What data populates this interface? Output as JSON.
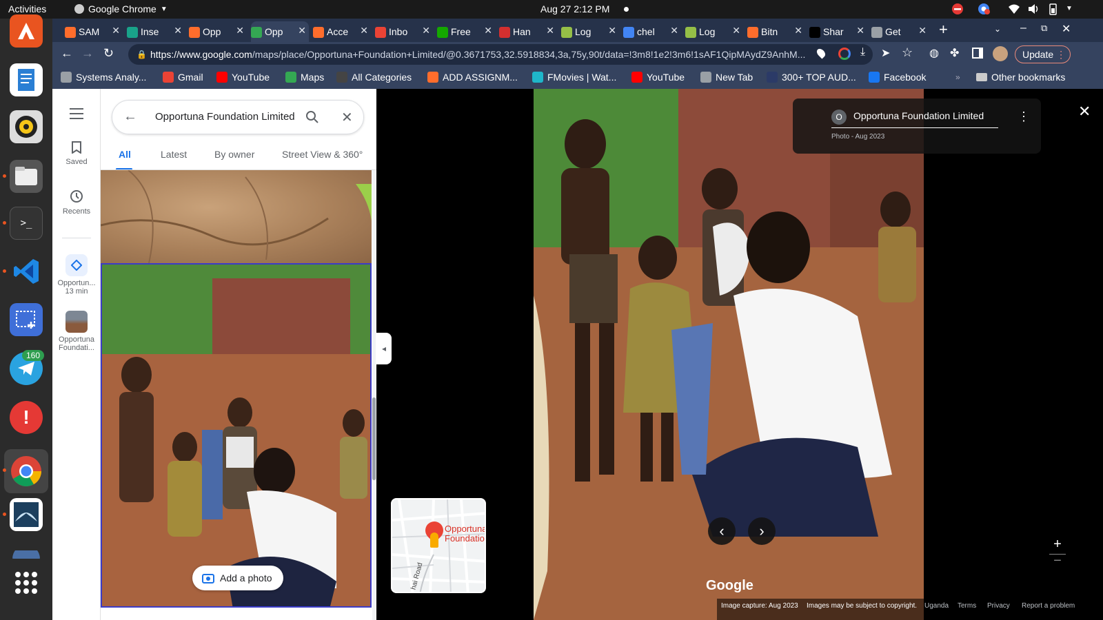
{
  "system": {
    "activities": "Activities",
    "app_name": "Google Chrome",
    "clock": "Aug 27  2:12 PM"
  },
  "dock": {
    "telegram_badge": "160"
  },
  "tabs": [
    {
      "label": "SAM",
      "color": "#ff6d2c"
    },
    {
      "label": "Inse",
      "color": "#19a38a"
    },
    {
      "label": "Opp",
      "color": "#ff6d2c"
    },
    {
      "label": "Opp",
      "color": "#34a853"
    },
    {
      "label": "Acce",
      "color": "#ff6d2c"
    },
    {
      "label": "Inbo",
      "color": "#ea4335"
    },
    {
      "label": "Free",
      "color": "#14a800"
    },
    {
      "label": "Han",
      "color": "#d32f2f"
    },
    {
      "label": "Log",
      "color": "#95bf47"
    },
    {
      "label": "chel",
      "color": "#4285f4"
    },
    {
      "label": "Log",
      "color": "#95bf47"
    },
    {
      "label": "Bitn",
      "color": "#ff6d2c"
    },
    {
      "label": "Shar",
      "color": "#000000"
    },
    {
      "label": "Get",
      "color": "#9aa0a6"
    }
  ],
  "browser": {
    "url_host": "https://www.google.com",
    "url_path": "/maps/place/Opportuna+Foundation+Limited/@0.3671753,32.5918834,3a,75y,90t/data=!3m8!1e2!3m6!1sAF1QipMAydZ9AnhM...",
    "update_label": "Update"
  },
  "bookmarks": [
    {
      "label": "Systems Analy...",
      "color": "#9aa0a6"
    },
    {
      "label": "Gmail",
      "color": "#ea4335"
    },
    {
      "label": "YouTube",
      "color": "#ff0000"
    },
    {
      "label": "Maps",
      "color": "#34a853"
    },
    {
      "label": "All Categories",
      "color": "#444444"
    },
    {
      "label": "ADD ASSIGNM...",
      "color": "#ff6d2c"
    },
    {
      "label": "FMovies | Wat...",
      "color": "#1fb6c9"
    },
    {
      "label": "YouTube",
      "color": "#ff0000"
    },
    {
      "label": "New Tab",
      "color": "#9aa0a6"
    },
    {
      "label": "300+ TOP AUD...",
      "color": "#2b3a67"
    },
    {
      "label": "Facebook",
      "color": "#1877f2"
    }
  ],
  "other_bookmarks": "Other bookmarks",
  "rail": {
    "saved": "Saved",
    "recents": "Recents",
    "recent1_name": "Opportun...",
    "recent1_sub": "13 min",
    "recent2_name": "Opportuna Foundati..."
  },
  "search": {
    "query": "Opportuna Foundation Limited"
  },
  "photo_tabs": [
    "All",
    "Latest",
    "By owner",
    "Street View & 360°"
  ],
  "add_photo_label": "Add a photo",
  "minimap": {
    "place_label": "Opportuna Foundatio",
    "road_label": "hai Road"
  },
  "viewer": {
    "avatar_letter": "O",
    "place_title": "Opportuna Foundation Limited",
    "photo_meta": "Photo - Aug 2023",
    "google_logo": "Google",
    "capture": "Image capture: Aug 2023",
    "copyright": "Images may be subject to copyright.",
    "links": [
      "Uganda",
      "Terms",
      "Privacy",
      "Report a problem"
    ]
  }
}
